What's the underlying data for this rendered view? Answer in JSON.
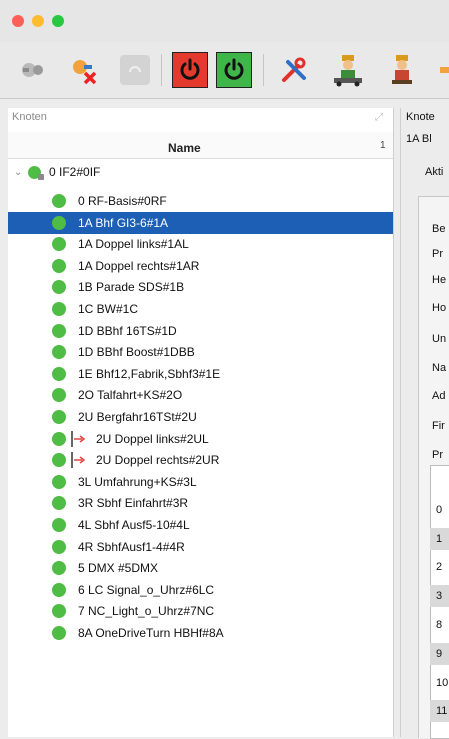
{
  "window": {
    "traffic_lights": [
      "close",
      "minimize",
      "zoom"
    ]
  },
  "toolbar": {
    "buttons": [
      {
        "icon": "disconnect-icon"
      },
      {
        "icon": "remove-connection-icon"
      },
      {
        "icon": "disabled-icon"
      },
      {
        "icon": "power-off-icon",
        "color": "#e43a2d"
      },
      {
        "icon": "power-on-icon",
        "color": "#3fb54a"
      },
      {
        "icon": "tools-icon"
      },
      {
        "icon": "worker-cart-icon"
      },
      {
        "icon": "worker-icon"
      }
    ]
  },
  "left_panel": {
    "title": "Knoten",
    "column_name": "Name",
    "column_index": "1",
    "root": "0 IF2#0IF",
    "nodes": [
      {
        "label": "0 RF-Basis#0RF",
        "selected": false,
        "branch": false
      },
      {
        "label": "1A Bhf GI3-6#1A",
        "selected": true,
        "branch": false
      },
      {
        "label": "1A Doppel links#1AL",
        "selected": false,
        "branch": false
      },
      {
        "label": "1A Doppel rechts#1AR",
        "selected": false,
        "branch": false
      },
      {
        "label": "1B Parade SDS#1B",
        "selected": false,
        "branch": false
      },
      {
        "label": "1C BW#1C",
        "selected": false,
        "branch": false
      },
      {
        "label": "1D BBhf 16TS#1D",
        "selected": false,
        "branch": false
      },
      {
        "label": "1D BBhf Boost#1DBB",
        "selected": false,
        "branch": false
      },
      {
        "label": "1E Bhf12,Fabrik,Sbhf3#1E",
        "selected": false,
        "branch": false
      },
      {
        "label": "2O Talfahrt+KS#2O",
        "selected": false,
        "branch": false
      },
      {
        "label": "2U Bergfahr16TSt#2U",
        "selected": false,
        "branch": false
      },
      {
        "label": "2U Doppel links#2UL",
        "selected": false,
        "branch": true
      },
      {
        "label": "2U Doppel rechts#2UR",
        "selected": false,
        "branch": true
      },
      {
        "label": "3L Umfahrung+KS#3L",
        "selected": false,
        "branch": false
      },
      {
        "label": "3R Sbhf Einfahrt#3R",
        "selected": false,
        "branch": false
      },
      {
        "label": "4L Sbhf Ausf5-10#4L",
        "selected": false,
        "branch": false
      },
      {
        "label": "4R SbhfAusf1-4#4R",
        "selected": false,
        "branch": false
      },
      {
        "label": "5 DMX #5DMX",
        "selected": false,
        "branch": false
      },
      {
        "label": "6 LC Signal_o_Uhrz#6LC",
        "selected": false,
        "branch": false
      },
      {
        "label": "7 NC_Light_o_Uhrz#7NC",
        "selected": false,
        "branch": false
      },
      {
        "label": "8A OneDriveTurn HBHf#8A",
        "selected": false,
        "branch": false
      }
    ]
  },
  "right_panel": {
    "title": "Knote",
    "subtitle": "1A Bl",
    "tab": "Akti",
    "field_labels": [
      "Be",
      "Pr",
      "He",
      "Ho",
      "Un",
      "Na",
      "Ad",
      "Fir",
      "Pr"
    ],
    "list_rows": [
      "0",
      "1",
      "2",
      "3",
      "8",
      "9",
      "10",
      "11"
    ]
  },
  "colors": {
    "selection": "#1d5fb4",
    "status_ok": "#4fbd45"
  }
}
